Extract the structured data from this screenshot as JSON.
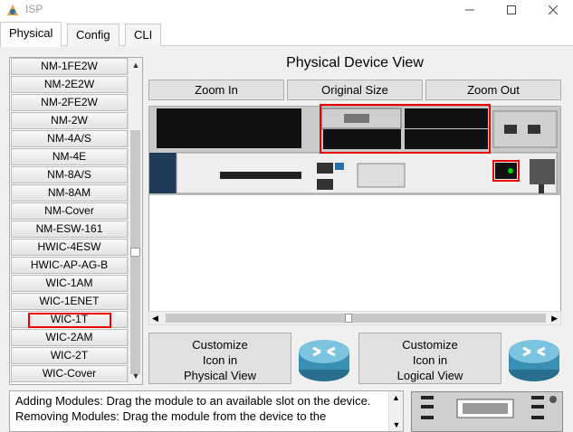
{
  "window": {
    "title": "ISP",
    "controls": [
      "minimize-icon",
      "maximize-icon",
      "close-icon"
    ]
  },
  "tabs": [
    {
      "label": "Physical",
      "active": true
    },
    {
      "label": "Config",
      "active": false
    },
    {
      "label": "CLI",
      "active": false
    }
  ],
  "modules": [
    "NM-1FE2W",
    "NM-2E2W",
    "NM-2FE2W",
    "NM-2W",
    "NM-4A/S",
    "NM-4E",
    "NM-8A/S",
    "NM-8AM",
    "NM-Cover",
    "NM-ESW-161",
    "HWIC-4ESW",
    "HWIC-AP-AG-B",
    "WIC-1AM",
    "WIC-1ENET",
    "WIC-1T",
    "WIC-2AM",
    "WIC-2T",
    "WIC-Cover"
  ],
  "selected_module": "WIC-1T",
  "device_view": {
    "title": "Physical Device View",
    "zoom_in": "Zoom In",
    "original_size": "Original Size",
    "zoom_out": "Zoom Out"
  },
  "customize": {
    "physical_lines": [
      "Customize",
      "Icon in",
      "Physical View"
    ],
    "logical_lines": [
      "Customize",
      "Icon in",
      "Logical View"
    ]
  },
  "info_text": "Adding Modules: Drag the module to an available slot on the device.",
  "info_text_cut": "Removing Modules: Drag the module from the device to the",
  "colors": {
    "highlight": "#e00000",
    "chassis": "#1f3b58",
    "router_blue": "#3a8fb5"
  }
}
